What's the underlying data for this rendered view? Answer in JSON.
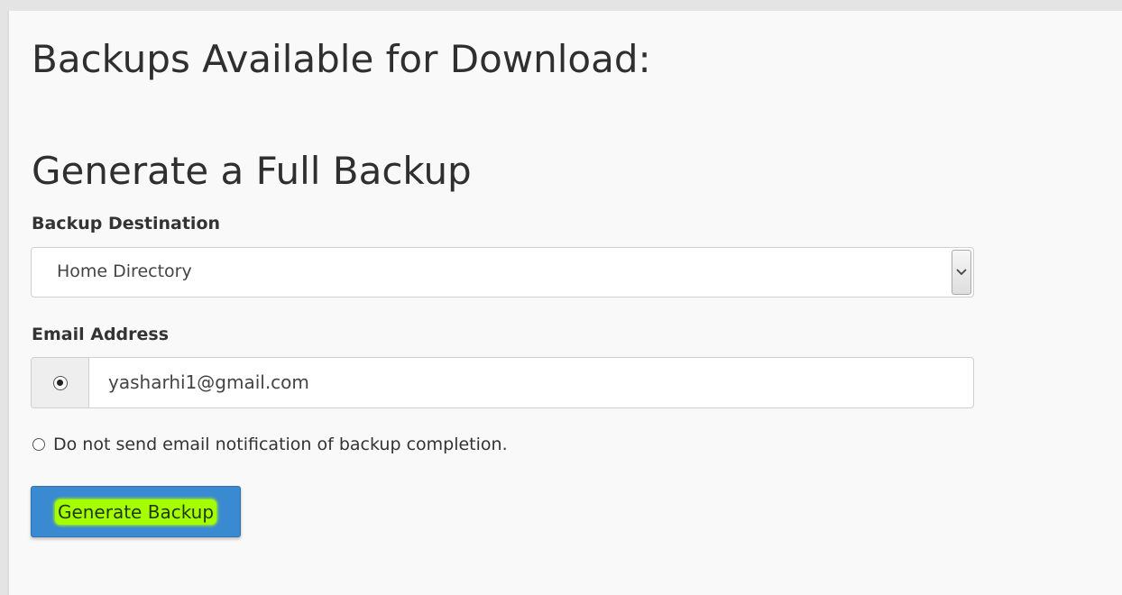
{
  "page": {
    "title": "Backups Available for Download:",
    "subtitle": "Generate a Full Backup"
  },
  "form": {
    "destination_label": "Backup Destination",
    "destination_value": "Home Directory",
    "destination_icon": "chevron-down-icon",
    "email_label": "Email Address",
    "email_value": "yasharhi1@gmail.com",
    "email_radio_selected": true,
    "no_email_option": "Do not send email notification of backup completion.",
    "no_email_selected": false,
    "generate_button": "Generate Backup"
  },
  "colors": {
    "button_bg": "#3a8ad1",
    "button_highlight": "#a6ff00",
    "panel_bg": "#f9f9f9"
  }
}
